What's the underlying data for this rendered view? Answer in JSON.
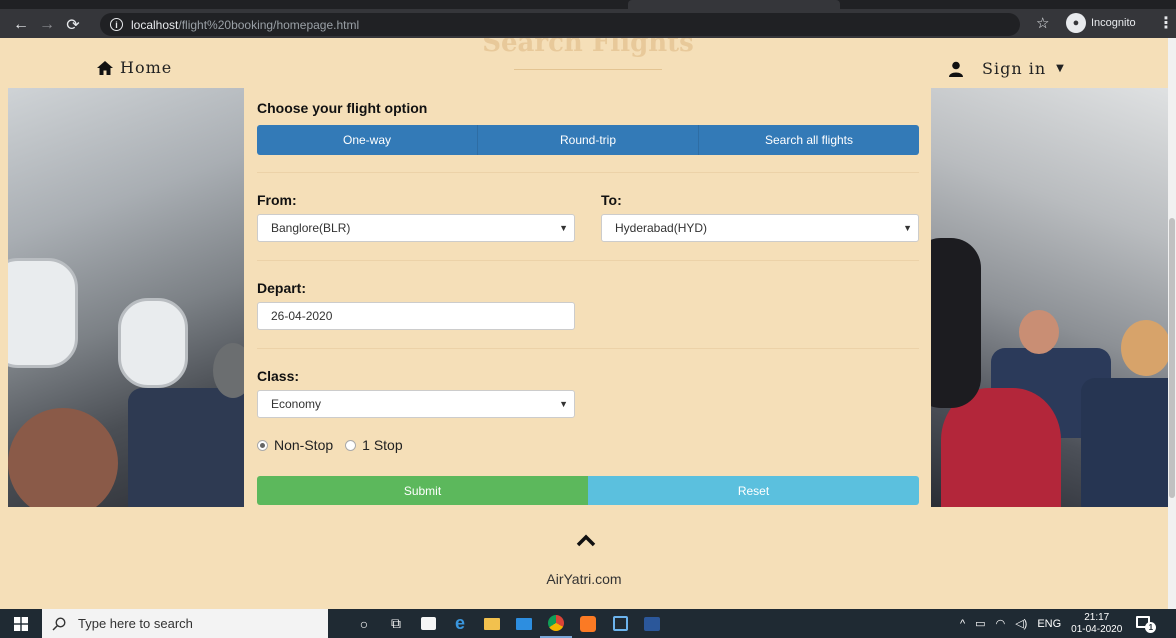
{
  "browser": {
    "url_host": "localhost",
    "url_path": "/flight%20booking/homepage.html",
    "incognito_label": "Incognito"
  },
  "nav": {
    "home_label": "Home",
    "signin_label": "Sign in"
  },
  "page": {
    "heading": "Search Flights"
  },
  "form": {
    "choose_label": "Choose your flight option",
    "options": [
      "One-way",
      "Round-trip",
      "Search all flights"
    ],
    "from_label": "From:",
    "from_value": "Banglore(BLR)",
    "to_label": "To:",
    "to_value": "Hyderabad(HYD)",
    "depart_label": "Depart:",
    "depart_value": "26-04-2020",
    "class_label": "Class:",
    "class_value": "Economy",
    "stops": [
      {
        "label": "Non-Stop",
        "selected": true
      },
      {
        "label": "1 Stop",
        "selected": false
      }
    ],
    "submit_label": "Submit",
    "reset_label": "Reset"
  },
  "footer": {
    "brand": "AirYatri.com"
  },
  "taskbar": {
    "search_placeholder": "Type here to search",
    "language": "ENG",
    "time": "21:17",
    "date": "01-04-2020",
    "notification_count": "1"
  },
  "colors": {
    "page_bg": "#f5dfb8",
    "primary": "#337ab7",
    "success": "#5cb85c",
    "info": "#5bc0de"
  }
}
